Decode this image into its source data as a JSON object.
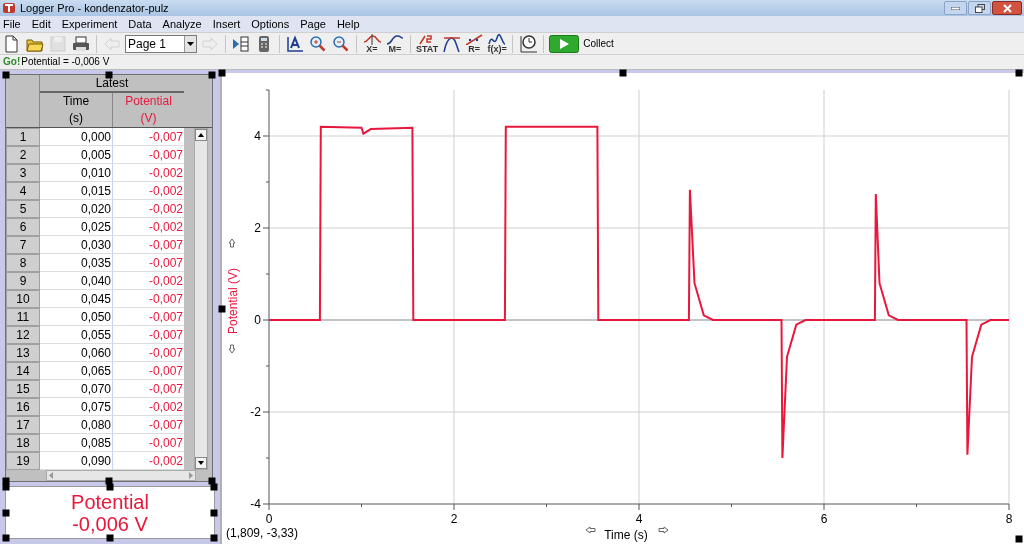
{
  "window": {
    "title": "Logger Pro - kondenzator-pulz"
  },
  "menu": [
    "File",
    "Edit",
    "Experiment",
    "Data",
    "Analyze",
    "Insert",
    "Options",
    "Page",
    "Help"
  ],
  "toolbar": [
    {
      "kind": "new",
      "disabled": false
    },
    {
      "kind": "open",
      "disabled": false
    },
    {
      "kind": "save",
      "disabled": true
    },
    {
      "kind": "print",
      "disabled": false
    },
    {
      "kind": "back",
      "disabled": true
    },
    {
      "kind": "page",
      "label": "Page 1",
      "disabled": false
    },
    {
      "kind": "forward",
      "disabled": true
    },
    {
      "kind": "sidebar",
      "disabled": false
    },
    {
      "kind": "calc",
      "disabled": false
    },
    {
      "kind": "autoscale",
      "disabled": false
    },
    {
      "kind": "zoomin",
      "disabled": false
    },
    {
      "kind": "zoomout",
      "disabled": false
    },
    {
      "kind": "examine",
      "label": "X=",
      "disabled": false
    },
    {
      "kind": "model",
      "label": "M=",
      "disabled": false
    },
    {
      "kind": "stats",
      "label": "STAT",
      "disabled": false
    },
    {
      "kind": "tangent",
      "disabled": false
    },
    {
      "kind": "fit",
      "label": "R=",
      "disabled": false
    },
    {
      "kind": "curvefit",
      "label": "f(x)=",
      "disabled": false
    },
    {
      "kind": "settings",
      "disabled": false
    },
    {
      "kind": "collect",
      "label": "Collect",
      "disabled": false
    }
  ],
  "status": {
    "logo": "Go!",
    "reading": "Potential = -0,006 V"
  },
  "table": {
    "group_header": "Latest",
    "columns": [
      {
        "name": "Time",
        "unit": "(s)",
        "color": "#000000"
      },
      {
        "name": "Potential",
        "unit": "(V)",
        "color": "#e8173c"
      }
    ],
    "rows": [
      {
        "index": "1",
        "cells": [
          "0,000",
          "-0,007"
        ]
      },
      {
        "index": "2",
        "cells": [
          "0,005",
          "-0,007"
        ]
      },
      {
        "index": "3",
        "cells": [
          "0,010",
          "-0,002"
        ]
      },
      {
        "index": "4",
        "cells": [
          "0,015",
          "-0,002"
        ]
      },
      {
        "index": "5",
        "cells": [
          "0,020",
          "-0,002"
        ]
      },
      {
        "index": "6",
        "cells": [
          "0,025",
          "-0,002"
        ]
      },
      {
        "index": "7",
        "cells": [
          "0,030",
          "-0,007"
        ]
      },
      {
        "index": "8",
        "cells": [
          "0,035",
          "-0,007"
        ]
      },
      {
        "index": "9",
        "cells": [
          "0,040",
          "-0,002"
        ]
      },
      {
        "index": "10",
        "cells": [
          "0,045",
          "-0,007"
        ]
      },
      {
        "index": "11",
        "cells": [
          "0,050",
          "-0,007"
        ]
      },
      {
        "index": "12",
        "cells": [
          "0,055",
          "-0,007"
        ]
      },
      {
        "index": "13",
        "cells": [
          "0,060",
          "-0,007"
        ]
      },
      {
        "index": "14",
        "cells": [
          "0,065",
          "-0,007"
        ]
      },
      {
        "index": "15",
        "cells": [
          "0,070",
          "-0,007"
        ]
      },
      {
        "index": "16",
        "cells": [
          "0,075",
          "-0,002"
        ]
      },
      {
        "index": "17",
        "cells": [
          "0,080",
          "-0,007"
        ]
      },
      {
        "index": "18",
        "cells": [
          "0,085",
          "-0,007"
        ]
      },
      {
        "index": "19",
        "cells": [
          "0,090",
          "-0,002"
        ]
      }
    ]
  },
  "meter": {
    "label": "Potential",
    "value": "-0,006 V",
    "color": "#e8173c"
  },
  "graph": {
    "coordinates": "(1,809, -3,33)",
    "chart_data": {
      "type": "line",
      "xlabel": "Time (s)",
      "ylabel": "Potential (V)",
      "x": [
        0,
        0.55,
        0.56,
        1.0,
        1.02,
        1.1,
        1.55,
        1.56,
        2.55,
        2.56,
        3.55,
        3.56,
        4.54,
        4.55,
        4.6,
        4.7,
        4.8,
        5.54,
        5.55,
        5.6,
        5.7,
        5.8,
        6.55,
        6.56,
        6.6,
        6.7,
        6.8,
        7.54,
        7.55,
        7.6,
        7.7,
        7.8,
        8
      ],
      "series": [
        {
          "color": "#e8173c",
          "values": [
            0,
            0,
            4.2,
            4.18,
            4.05,
            4.15,
            4.18,
            0,
            0,
            4.2,
            4.2,
            0,
            0,
            2.83,
            0.8,
            0.1,
            0,
            0,
            -3.0,
            -0.8,
            -0.1,
            0,
            0,
            2.74,
            0.8,
            0.1,
            0,
            0,
            -2.93,
            -0.8,
            -0.1,
            0,
            0
          ]
        }
      ],
      "xlim": [
        0,
        8
      ],
      "ylim": [
        -4,
        5
      ],
      "xticks": [
        0,
        2,
        4,
        6,
        8
      ],
      "yticks": [
        -4,
        -2,
        0,
        2,
        4
      ],
      "grid": true
    }
  }
}
